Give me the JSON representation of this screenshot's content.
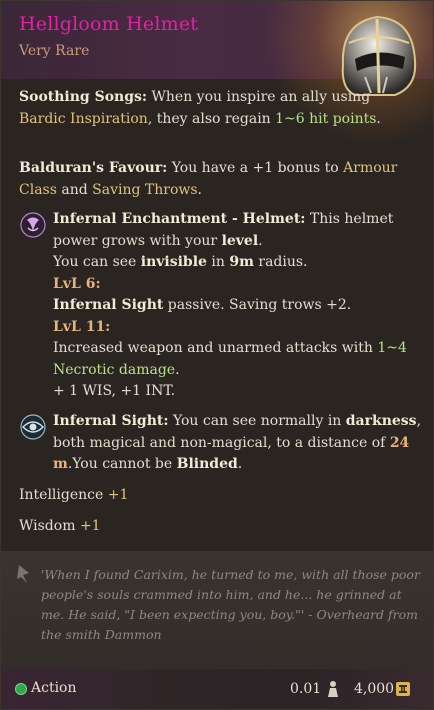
{
  "item": {
    "name": "Hellgloom Helmet",
    "rarity": "Very Rare"
  },
  "colors": {
    "title": "#e61fa6",
    "rarity": "#c79b78",
    "keyword_gold": "#e0c27a",
    "keyword_green": "#b7e089",
    "action_dot": "#2fa84b"
  },
  "soothing": {
    "title": "Soothing Songs:",
    "t1": " When you inspire an ally using ",
    "link": "Bardic Inspiration",
    "t2": ", they also regain ",
    "heal": "1~6 hit points",
    "t3": "."
  },
  "favour": {
    "title": "Balduran's Favour:",
    "t1": " You have a +1 bonus to ",
    "k1": "Armour Class",
    "t2": " and ",
    "k2": "Saving Throws",
    "t3": "."
  },
  "enchant": {
    "icon": "infernal-enchantment-icon",
    "title": "Infernal Enchantment - Helmet:",
    "t1": " This helmet power grows with your ",
    "level_word": "level",
    "t2": ".",
    "l2a": "You can see ",
    "invisible": "invisible",
    "l2b": " in ",
    "radius": "9m",
    "l2c": " radius.",
    "lvl6": "LvL 6:",
    "sight_name": "Infernal Sight",
    "l3": " passive. Saving trows +2.",
    "lvl11": "LvL 11:",
    "l4a": "Increased weapon and unarmed attacks with ",
    "dmg": "1~4 Necrotic damage",
    "l4b": ".",
    "l5": "+ 1 WIS, +1 INT."
  },
  "sight": {
    "icon": "infernal-sight-icon",
    "title": "Infernal Sight:",
    "t1": " You can see normally in ",
    "dark": "darkness",
    "t2": ", both magical and non-magical, to a distance of ",
    "dist": "24 m",
    "t3": ".You cannot be ",
    "blinded": "Blinded",
    "t4": "."
  },
  "stats": [
    {
      "name": "Intelligence",
      "value": "+1"
    },
    {
      "name": "Wisdom",
      "value": "+1"
    }
  ],
  "quote": "'When I found Carixim, he turned to me, with all those poor people's souls crammed into him, and he... he grinned at me. He said, \"I been expecting you, boy.\"' - Overheard from the smith Dammon",
  "footer": {
    "action": "Action",
    "weight": "0.01",
    "price": "4,000"
  }
}
